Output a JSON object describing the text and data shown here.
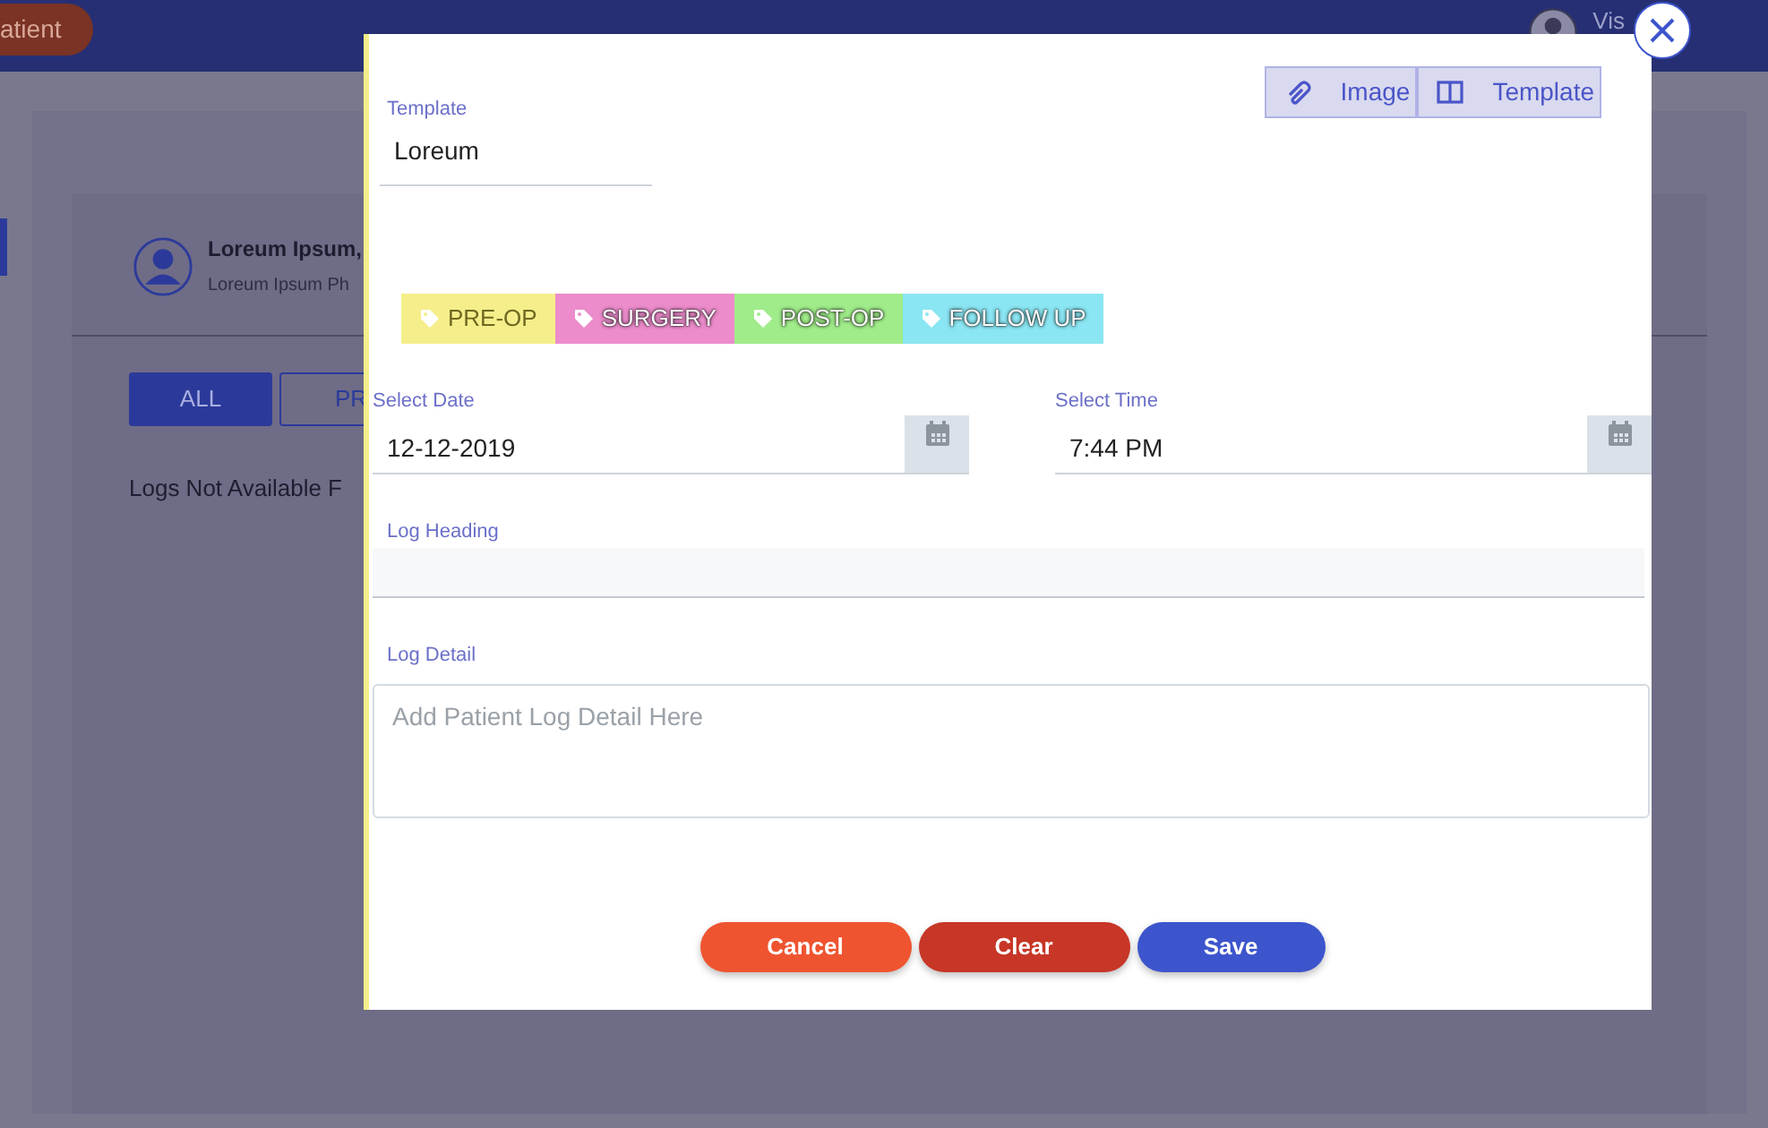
{
  "background": {
    "nav_button": "atient",
    "user_name": "Vis",
    "profile": {
      "name": "Loreum Ipsum,",
      "subtitle": "Loreum Ipsum Ph"
    },
    "filters": [
      {
        "label": "ALL",
        "selected": true
      },
      {
        "label": "PR",
        "selected": false
      }
    ],
    "empty_message": "Logs Not Available F"
  },
  "modal": {
    "template": {
      "label": "Template",
      "value": "Loreum"
    },
    "attach_buttons": [
      {
        "kind": "image",
        "label": "Image"
      },
      {
        "kind": "template",
        "label": "Template"
      }
    ],
    "tags": [
      {
        "label": "PRE-OP",
        "color": "#f5ee8a"
      },
      {
        "label": "SURGERY",
        "color": "#ec8ccb"
      },
      {
        "label": "POST-OP",
        "color": "#a0ec8a"
      },
      {
        "label": "FOLLOW UP",
        "color": "#8ae6f2"
      }
    ],
    "date": {
      "label": "Select Date",
      "value": "12-12-2019"
    },
    "time": {
      "label": "Select Time",
      "value": "7:44 PM"
    },
    "log_heading": {
      "label": "Log Heading"
    },
    "log_detail": {
      "label": "Log Detail",
      "placeholder": "Add Patient Log Detail Here"
    },
    "actions": [
      {
        "kind": "cancel",
        "label": "Cancel"
      },
      {
        "kind": "clear",
        "label": "Clear"
      },
      {
        "kind": "save",
        "label": "Save"
      }
    ]
  }
}
